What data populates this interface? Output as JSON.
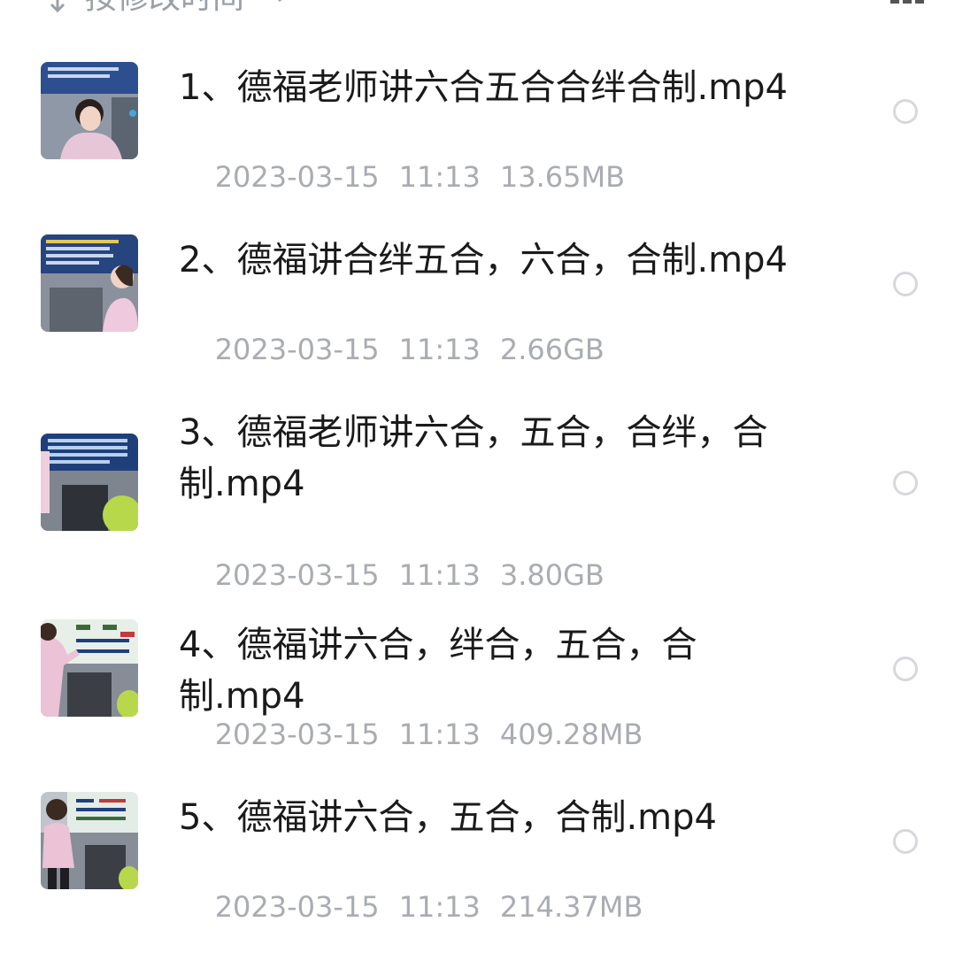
{
  "toolbar": {
    "sort_label": "按修改时间",
    "sort_icon": "sort-arrow-icon",
    "chevron_icon": "chevron-down-icon",
    "view_icon": "grid-view-icon"
  },
  "files": [
    {
      "name": "1、德福老师讲六合五合合绊合制.mp4",
      "date": "2023-03-15",
      "time": "11:13",
      "size": "13.65MB"
    },
    {
      "name": "2、德福讲合绊五合，六合，合制.mp4",
      "date": "2023-03-15",
      "time": "11:13",
      "size": "2.66GB"
    },
    {
      "name": "3、德福老师讲六合，五合，合绊，合制.mp4",
      "date": "2023-03-15",
      "time": "11:13",
      "size": "3.80GB"
    },
    {
      "name": "4、德福讲六合，绊合，五合，合制.mp4",
      "date": "2023-03-15",
      "time": "11:13",
      "size": "409.28MB"
    },
    {
      "name": "5、德福讲六合，五合，合制.mp4",
      "date": "2023-03-15",
      "time": "11:13",
      "size": "214.37MB"
    }
  ],
  "colors": {
    "name_text": "#1a1a1a",
    "meta_text": "#a9acb2",
    "radio_border": "#d6d8dc"
  }
}
